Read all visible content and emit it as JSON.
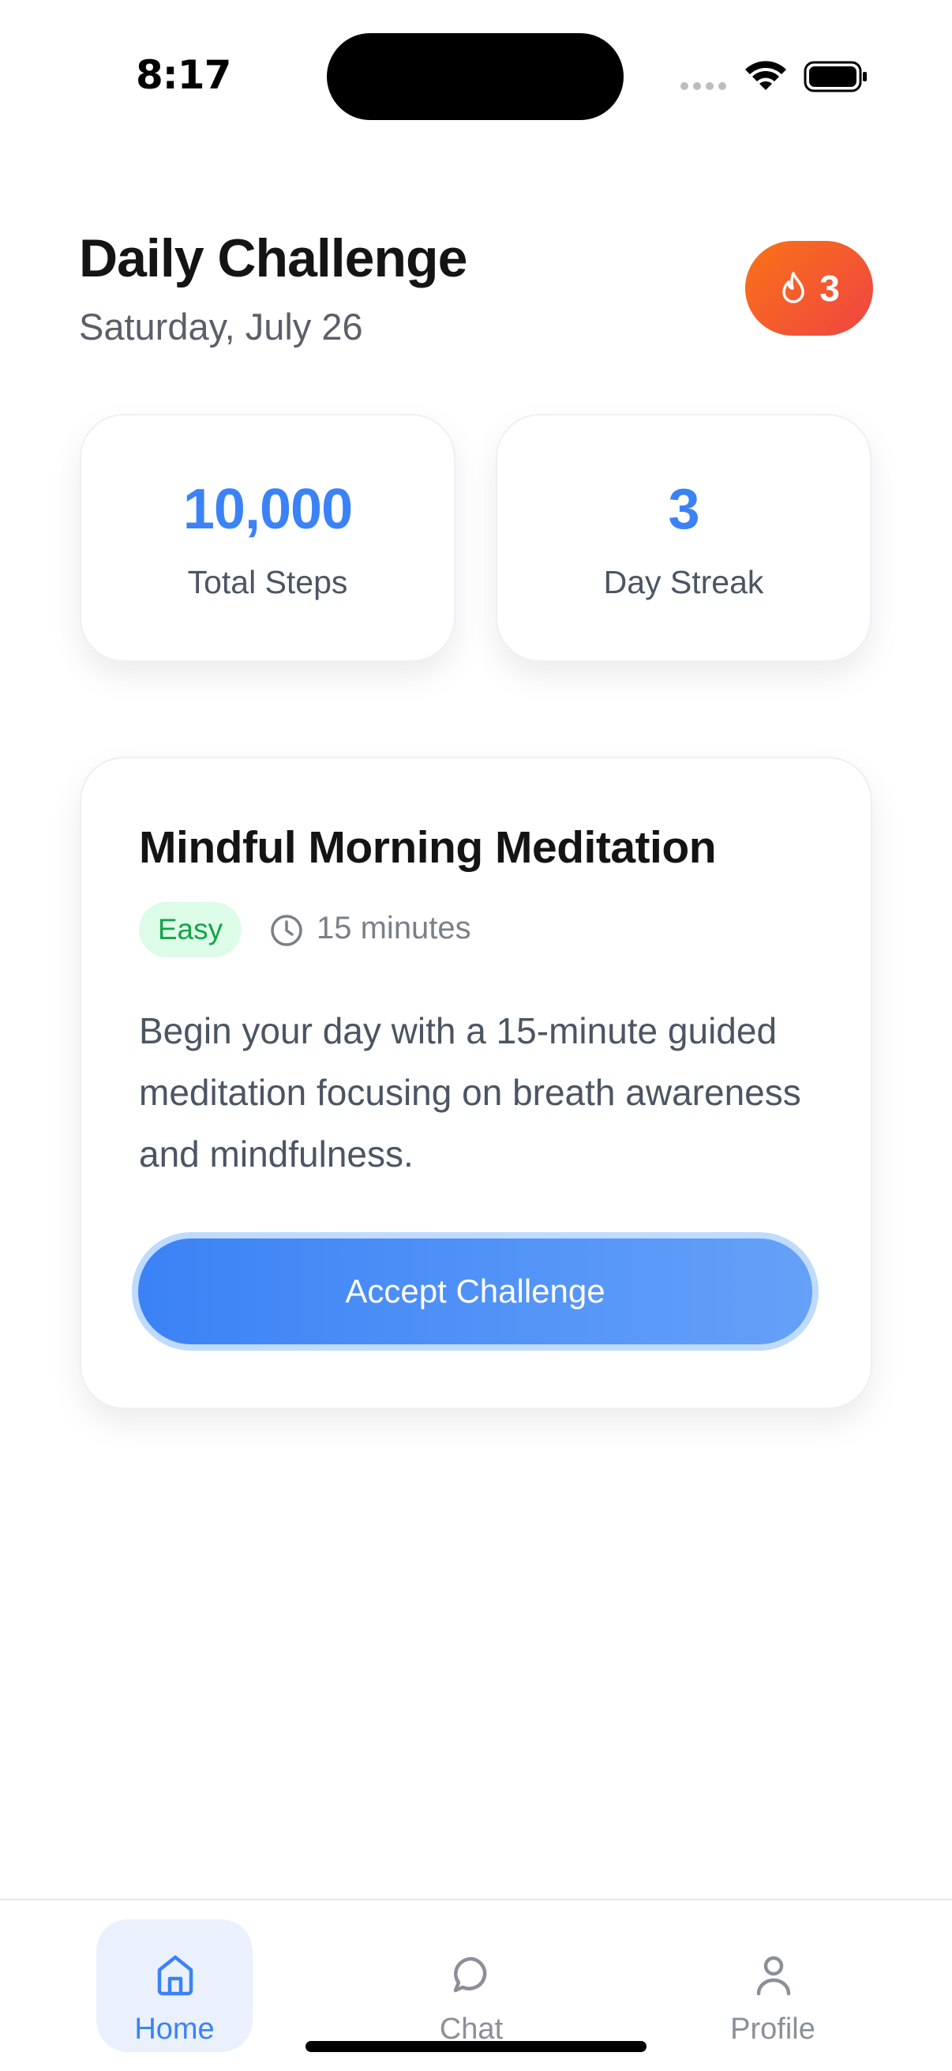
{
  "status_bar": {
    "time": "8:17"
  },
  "header": {
    "title": "Daily Challenge",
    "date": "Saturday, July 26",
    "streak_badge_count": "3"
  },
  "stats": [
    {
      "value": "10,000",
      "label": "Total Steps"
    },
    {
      "value": "3",
      "label": "Day Streak"
    }
  ],
  "challenge": {
    "title": "Mindful Morning Meditation",
    "difficulty": "Easy",
    "duration": "15 minutes",
    "description": "Begin your day with a 15-minute guided meditation focusing on breath awareness and mindfulness.",
    "accept_label": "Accept Challenge"
  },
  "nav": {
    "items": [
      {
        "label": "Home",
        "icon": "home-icon",
        "active": true
      },
      {
        "label": "Chat",
        "icon": "chat-icon",
        "active": false
      },
      {
        "label": "Profile",
        "icon": "profile-icon",
        "active": false
      }
    ]
  },
  "colors": {
    "accent": "#3b82f6",
    "streak_gradient_start": "#f97316",
    "streak_gradient_end": "#ef4444",
    "easy_badge_bg": "#dcfce7",
    "easy_badge_text": "#16a34a"
  }
}
